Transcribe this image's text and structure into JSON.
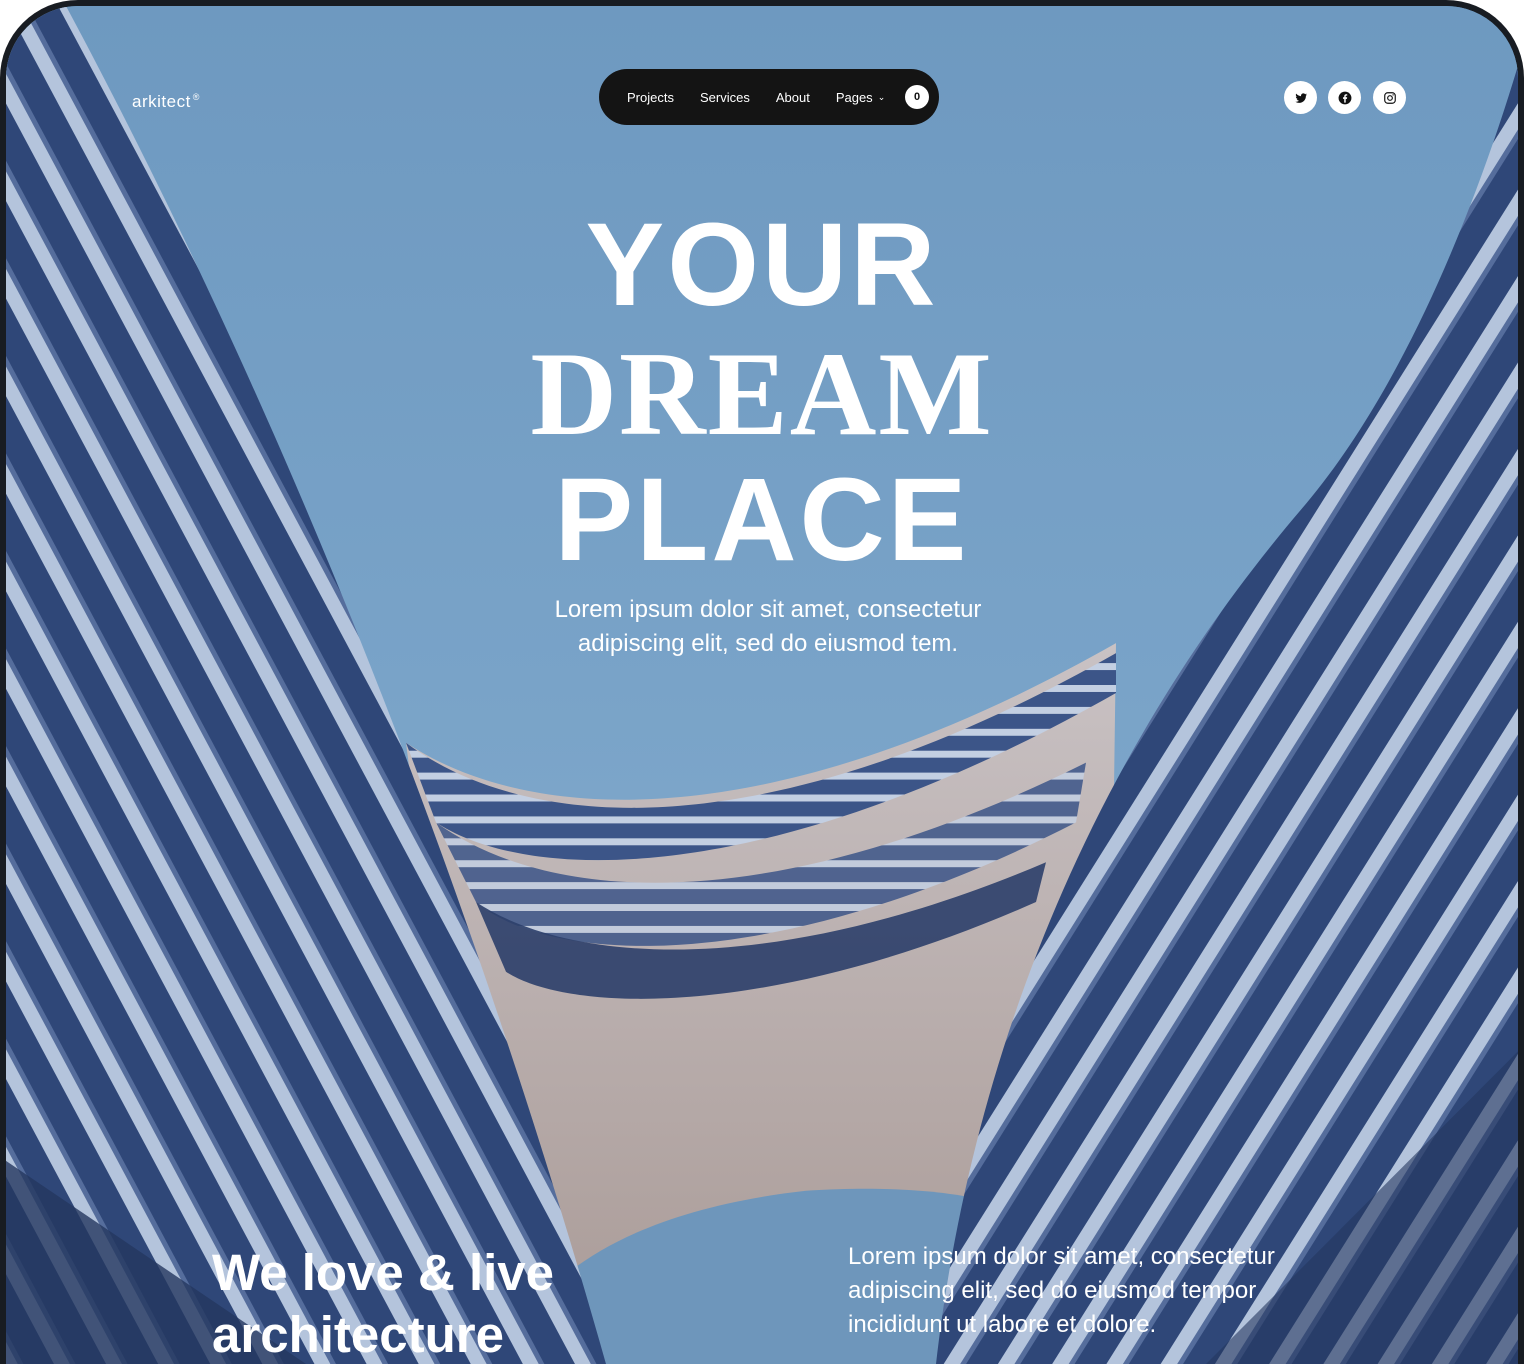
{
  "brand": {
    "name": "arkitect",
    "mark": "®"
  },
  "nav": {
    "items": [
      {
        "label": "Projects"
      },
      {
        "label": "Services"
      },
      {
        "label": "About"
      },
      {
        "label": "Pages"
      }
    ],
    "cart_count": "0"
  },
  "social": [
    {
      "icon": "twitter-icon"
    },
    {
      "icon": "facebook-icon"
    },
    {
      "icon": "instagram-icon"
    }
  ],
  "hero": {
    "line1": "YOUR",
    "line2": "DREAM",
    "line3": "PLACE",
    "subtitle": "Lorem ipsum dolor sit amet, consectetur adipiscing elit, sed do eiusmod tem."
  },
  "intro": {
    "tagline": "We love & live architecture",
    "text": "Lorem ipsum dolor sit amet, consectetur adipiscing elit, sed do eiusmod tempor incididunt ut labore et dolore."
  },
  "colors": {
    "sky": "#6c9bc3",
    "building_dark": "#2e4678",
    "building_light": "#a9bdd8",
    "atrium": "#b7aaa3",
    "nav_bg": "#141414",
    "frame": "#181c22"
  }
}
